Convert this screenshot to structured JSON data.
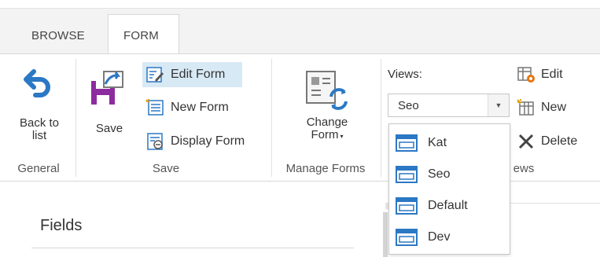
{
  "tabs": {
    "browse": "BROWSE",
    "form": "FORM"
  },
  "general": {
    "back_label_line1": "Back to",
    "back_label_line2": "list",
    "group_label": "General"
  },
  "save_group": {
    "save_label": "Save",
    "edit_form": "Edit Form",
    "new_form": "New Form",
    "display_form": "Display Form",
    "group_label": "Save"
  },
  "manage": {
    "change_line1": "Change",
    "change_line2": "Form",
    "group_label": "Manage Forms"
  },
  "views": {
    "label": "Views:",
    "selected": "Seo",
    "edit": "Edit",
    "new": "New",
    "delete": "Delete",
    "group_label_partial": "ews",
    "options": [
      "Kat",
      "Seo",
      "Default",
      "Dev"
    ]
  },
  "main": {
    "fields_title": "Fields"
  },
  "colors": {
    "accent_blue": "#2b78c4",
    "save_purple": "#8d2c9e",
    "active_bg": "#d8e9f6"
  }
}
